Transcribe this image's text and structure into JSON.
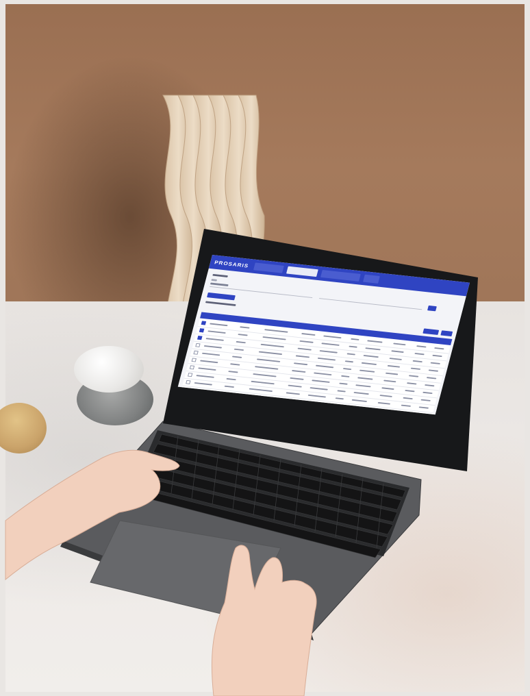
{
  "screen": {
    "brand": "PROSARIS",
    "header_tab_count": 4,
    "active_header_tab": 2,
    "table_row_count": 9,
    "checked_rows": [
      1,
      2,
      3
    ]
  },
  "colors": {
    "accent": "#2f44c2",
    "screen_background": "#f3f4f8",
    "wall": "#a57a5c",
    "tabletop": "#eeeae7"
  }
}
